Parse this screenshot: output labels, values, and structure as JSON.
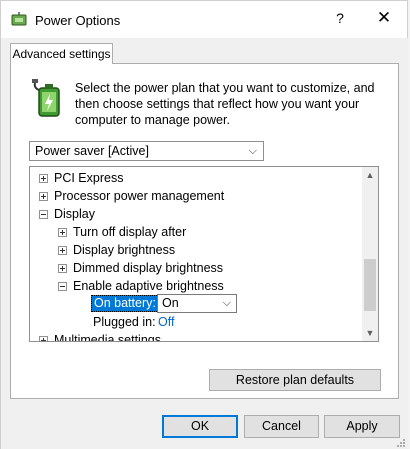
{
  "window": {
    "title": "Power Options",
    "help_glyph": "?",
    "close_glyph": "✕"
  },
  "tabs": [
    {
      "label": "Advanced settings",
      "active": true
    }
  ],
  "description": "Select the power plan that you want to customize, and then choose settings that reflect how you want your computer to manage power.",
  "plan_select": {
    "value": "Power saver [Active]"
  },
  "tree": {
    "items": [
      {
        "label": "PCI Express",
        "level": 0,
        "expanded": false
      },
      {
        "label": "Processor power management",
        "level": 0,
        "expanded": false
      },
      {
        "label": "Display",
        "level": 0,
        "expanded": true
      },
      {
        "label": "Turn off display after",
        "level": 1,
        "expanded": false
      },
      {
        "label": "Display brightness",
        "level": 1,
        "expanded": false
      },
      {
        "label": "Dimmed display brightness",
        "level": 1,
        "expanded": false
      },
      {
        "label": "Enable adaptive brightness",
        "level": 1,
        "expanded": true
      },
      {
        "label": "Multimedia settings",
        "level": 0,
        "expanded": false
      }
    ],
    "on_battery": {
      "label": "On battery:",
      "value": "On"
    },
    "plugged_in": {
      "label": "Plugged in:",
      "value": "Off"
    }
  },
  "buttons": {
    "restore": "Restore plan defaults",
    "ok": "OK",
    "cancel": "Cancel",
    "apply": "Apply"
  },
  "colors": {
    "selection": "#0078d7",
    "link_value": "#0066cc",
    "dialog_bg": "#f0f0f0"
  }
}
